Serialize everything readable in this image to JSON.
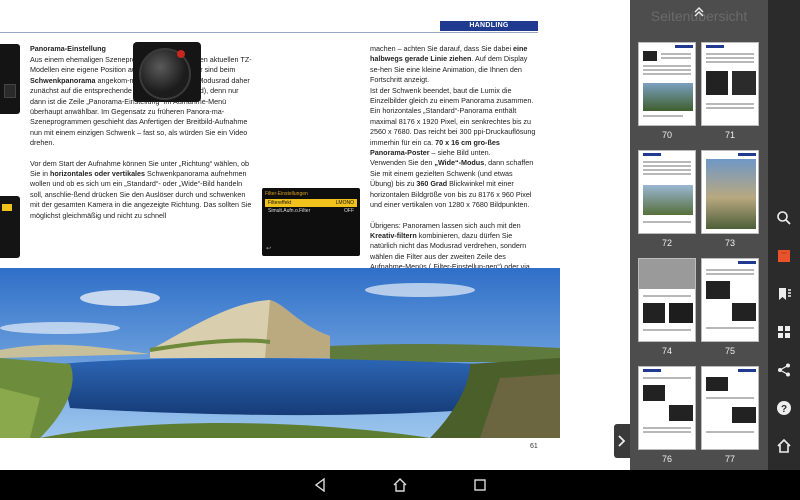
{
  "section_tag": "HANDLING",
  "col1": {
    "heading": "Panorama-Einstellung",
    "p1a": "Aus einem ehemaligen Szenepro-gramm wurde bei den aktuellen TZ-Modellen eine eigene Position auf dem Modusrad: Wir sind beim ",
    "p1b": "Schwenkpanorama",
    "p1c": " angekom-men. Stellen Sie das Modusrad daher zunächst auf die entsprechende Position (Kreis im Bild), denn nur dann ist die Zeile „Panorama-Einstellung“ im Aufnahme-Menü überhaupt anwählbar. Im Gegensatz zu früheren Panora-ma-Szeneprogrammen geschieht das Anfertigen der Breitbild-Aufnahme nun mit einem einzigen Schwenk – fast so, als würden Sie ein Video drehen.",
    "p2a": "Vor dem Start der Aufnahme können Sie unter „Richtung“ wählen, ob Sie in ",
    "p2b": "horizontales oder vertikales",
    "p2c": " Schwenkpanorama aufnehmen wollen und ob es sich um ein „Standard“- oder „Wide“-Bild handeln soll, anschlie-ßend drücken Sie den Auslöser durch und schwenken mit der gesamten Kamera in die angezeigte Richtung. Das sollten Sie möglichst gleichmäßig und nicht zu schnell"
  },
  "col2": {
    "p1a": "machen – achten Sie darauf, dass Sie dabei ",
    "p1b": "eine halbwegs gerade Linie ziehen",
    "p1c": ". Auf dem Display se-hen Sie eine kleine Animation, die Ihnen den Fortschritt anzeigt.",
    "p2a": "Ist der Schwenk beendet, baut die Lumix die Einzelbilder gleich zu einem Panorama zusammen. Ein horizontales „Standard“-Panorama enthält maximal 8176 x 1920 Pixel, ein senkrechtes bis zu 2560 x 7680. Das reicht bei 300 ppi-Druckauflösung immerhin für ein ca. ",
    "p2b": "70 x 16 cm gro-ßes Panorama-Poster",
    "p2c": " – siehe Bild unten.",
    "p3a": "Verwenden Sie den ",
    "p3b": "„Wide“-Modus",
    "p3c": ", dann schaffen Sie mit einem gezielten Schwenk (und etwas Übung) bis zu ",
    "p3d": "360 Grad",
    "p3e": " Blickwinkel mit einer horizontalen Bildgröße von bis zu 8176 x 960 Pixel und einer vertikalen von 1280 x 7680 Bildpunkten.",
    "p4a": "Übrigens: Panoramen lassen sich auch mit den ",
    "p4b": "Kreativ-filtern",
    "p4c": " kombinieren, dazu dürfen Sie natürlich nicht das Modusrad verdrehen, sondern wählen die Filter aus der zweiten Zeile des Aufnahme-Menüs („Filter-Einstellun-gen“) oder via Touchscreen aus."
  },
  "menu_shot": {
    "title": "Filter-Einstellungen",
    "rows": [
      {
        "label": "Filtereffekt",
        "value": "LMONO"
      },
      {
        "label": "Simult.Aufn.o.Filter",
        "value": "OFF"
      }
    ]
  },
  "page_number": "61",
  "overview": {
    "title": "Seitenübersicht",
    "pages": [
      "70",
      "71",
      "72",
      "73",
      "74",
      "75",
      "76",
      "77"
    ]
  },
  "colors": {
    "accent": "#1f3a8f",
    "panel": "#4d4d4d",
    "toolbar": "#2b2b2b",
    "highlight": "#e8532c"
  },
  "toolbar_icons": [
    "search-icon",
    "bookmark-square-icon",
    "bookmark-list-icon",
    "grid-icon",
    "share-icon",
    "help-icon",
    "home-icon"
  ],
  "nav_icons": [
    "back-icon",
    "home-icon",
    "recents-icon"
  ]
}
